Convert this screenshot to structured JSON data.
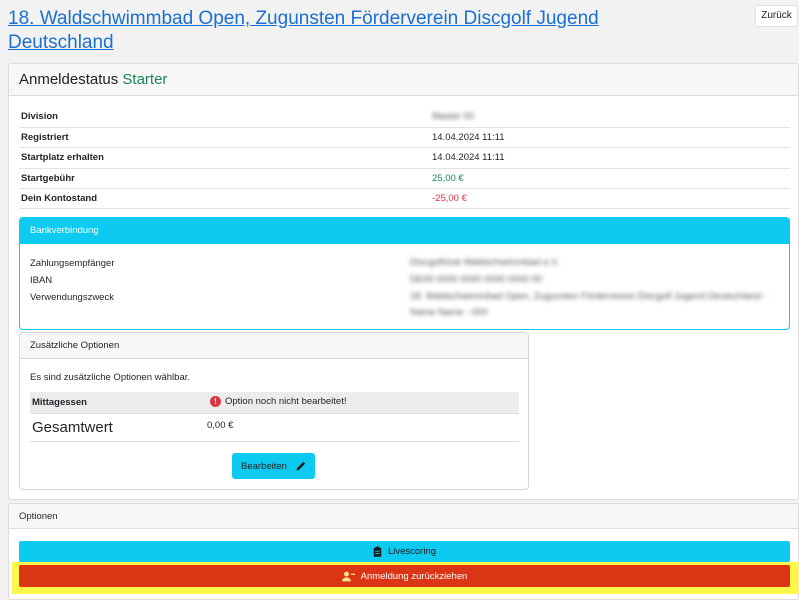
{
  "header": {
    "title": "18. Waldschwimmbad Open, Zugunsten Förderverein Discgolf Jugend Deutschland",
    "back_label": "Zurück"
  },
  "status": {
    "heading": "Anmeldestatus",
    "value": "Starter",
    "value_color": "#198754"
  },
  "info_rows": [
    {
      "label": "Division",
      "value": "Master 50"
    },
    {
      "label": "Registriert",
      "value": "14.04.2024 11:11"
    },
    {
      "label": "Startplatz erhalten",
      "value": "14.04.2024 11:11"
    },
    {
      "label": "Startgebühr",
      "value": "25,00 €"
    },
    {
      "label": "Dein Kontostand",
      "value": "-25,00 €"
    }
  ],
  "bank": {
    "title": "Bankverbindung",
    "rows": [
      {
        "label": "Zahlungsempfänger",
        "value": "Discgolfclub Waldschwimmbad e.V."
      },
      {
        "label": "IBAN",
        "value": "DE00 0000 0000 0000 0000 00"
      },
      {
        "label": "Verwendungszweck",
        "value": "18. Waldschwimmbad Open, Zugunsten Förderverein Discgolf Jugend Deutschland - Name Name - 000"
      }
    ]
  },
  "extra_options": {
    "title": "Zusätzliche Optionen",
    "description": "Es sind zusätzliche Optionen wählbar.",
    "option_name": "Mittagessen",
    "option_status": "Option noch nicht bearbeitet!",
    "total_label": "Gesamtwert",
    "total_value": "0,00 €",
    "edit_label": "Bearbeiten"
  },
  "options": {
    "title": "Optionen",
    "livescoring_label": "Livescoring",
    "withdraw_label": "Anmeldung zurückziehen"
  },
  "colors": {
    "info": "#0dcaf0",
    "danger": "#dc3516",
    "link": "#1a6fd0",
    "highlight": "#fff64a"
  },
  "icons": {
    "error": "exclamation-circle-icon",
    "edit": "pencil-icon",
    "livescoring": "clipboard-icon",
    "withdraw": "user-remove-icon"
  }
}
